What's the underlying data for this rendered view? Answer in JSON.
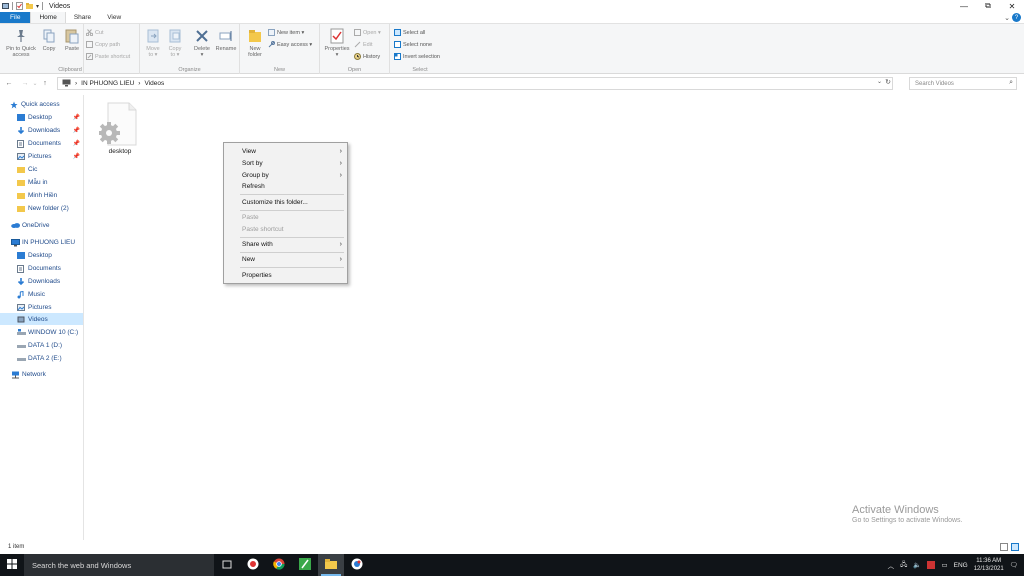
{
  "window": {
    "title": "Videos",
    "controls": {
      "minimize": "—",
      "maximize": "⧉",
      "close": "✕"
    }
  },
  "ribbon_tabs": [
    {
      "label": "File"
    },
    {
      "label": "Home"
    },
    {
      "label": "Share"
    },
    {
      "label": "View"
    }
  ],
  "ribbon": {
    "clipboard": {
      "group_label": "Clipboard",
      "pin_label_1": "Pin to Quick",
      "pin_label_2": "access",
      "copy_label": "Copy",
      "paste_label": "Paste",
      "cut_label": "Cut",
      "copy_path_label": "Copy path",
      "paste_shortcut_label": "Paste shortcut"
    },
    "organize": {
      "group_label": "Organize",
      "move_to_1": "Move",
      "move_to_2": "to ▾",
      "copy_to_1": "Copy",
      "copy_to_2": "to ▾",
      "delete_1": "Delete",
      "delete_2": "▾",
      "rename_label": "Rename"
    },
    "new": {
      "group_label": "New",
      "new_folder_1": "New",
      "new_folder_2": "folder",
      "new_item_label": "New item ▾",
      "easy_access_label": "Easy access ▾"
    },
    "open": {
      "group_label": "Open",
      "properties_1": "Properties",
      "properties_2": "▾",
      "open_label": "Open ▾",
      "edit_label": "Edit",
      "history_label": "History"
    },
    "select": {
      "group_label": "Select",
      "select_all_label": "Select all",
      "select_none_label": "Select none",
      "invert_label": "Invert selection"
    }
  },
  "address": {
    "path": [
      "IN PHUONG LIEU",
      "Videos"
    ],
    "separator": "›",
    "search_placeholder": "Search Videos"
  },
  "nav_pane": {
    "quick_access": "Quick access",
    "qa_items": [
      {
        "label": "Desktop",
        "pinned": "📌"
      },
      {
        "label": "Downloads",
        "pinned": "📌"
      },
      {
        "label": "Documents",
        "pinned": "📌"
      },
      {
        "label": "Pictures",
        "pinned": "📌"
      },
      {
        "label": "Cic"
      },
      {
        "label": "Mẫu in"
      },
      {
        "label": "Minh Hiền"
      },
      {
        "label": "New folder (2)"
      }
    ],
    "onedrive": "OneDrive",
    "this_pc": "IN PHUONG LIEU",
    "pc_items": [
      {
        "label": "Desktop"
      },
      {
        "label": "Documents"
      },
      {
        "label": "Downloads"
      },
      {
        "label": "Music"
      },
      {
        "label": "Pictures"
      },
      {
        "label": "Videos"
      },
      {
        "label": "WINDOW 10 (C:)"
      },
      {
        "label": "DATA 1 (D:)"
      },
      {
        "label": "DATA 2 (E:)"
      }
    ],
    "network": "Network"
  },
  "content": {
    "files": [
      {
        "name": "desktop"
      }
    ]
  },
  "context_menu": {
    "items": [
      {
        "label": "View",
        "submenu": "›"
      },
      {
        "label": "Sort by",
        "submenu": "›"
      },
      {
        "label": "Group by",
        "submenu": "›"
      },
      {
        "label": "Refresh"
      },
      {
        "label": "Customize this folder..."
      },
      {
        "label": "Paste",
        "disabled": true
      },
      {
        "label": "Paste shortcut",
        "disabled": true
      },
      {
        "label": "Share with",
        "submenu": "›"
      },
      {
        "label": "New",
        "submenu": "›"
      },
      {
        "label": "Properties"
      }
    ]
  },
  "watermark": {
    "line1": "Activate Windows",
    "line2": "Go to Settings to activate Windows."
  },
  "statusbar": {
    "item_count": "1 item"
  },
  "taskbar": {
    "search_placeholder": "Search the web and Windows",
    "language": "ENG",
    "time": "11:36 AM",
    "date": "12/13/2021"
  },
  "colors": {
    "accent": "#1979ca",
    "selection": "#cce8ff",
    "taskbar": "#101418"
  }
}
